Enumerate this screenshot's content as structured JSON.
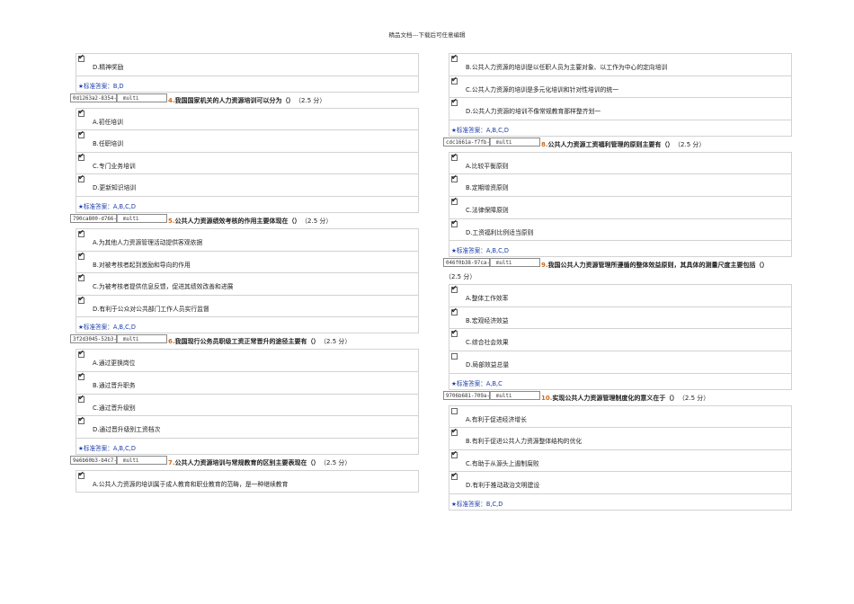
{
  "header": {
    "text": "精品文档---下载后可任意编辑"
  },
  "left": {
    "q3_tail": {
      "options": [
        {
          "label": "D.精神奖励",
          "checked": true
        }
      ],
      "answer_label": "★标准答案：",
      "answer": "B,D"
    },
    "questions": [
      {
        "id": "0d1263a2-8354-",
        "type": "multi",
        "number": "4.",
        "text": "我国国家机关的人力资源培训可以分为（）",
        "score": "（2.5 分）",
        "options": [
          {
            "label": "A.初任培训",
            "checked": true
          },
          {
            "label": "B.任职培训",
            "checked": true
          },
          {
            "label": "C.专门业务培训",
            "checked": true
          },
          {
            "label": "D.更新知识培训",
            "checked": true
          }
        ],
        "answer_label": "★标准答案：",
        "answer": "A,B,C,D"
      },
      {
        "id": "790ca800-d766-",
        "type": "multi",
        "number": "5.",
        "text": "公共人力资源绩效考核的作用主要体现在（）",
        "score": "（2.5 分）",
        "options": [
          {
            "label": "A.为其他人力资源管理活动提供客观依据",
            "checked": true
          },
          {
            "label": "B.对被考核者起到激励和导向的作用",
            "checked": true
          },
          {
            "label": "C.为被考核者提供信息反馈，促进其绩效改善和进展",
            "checked": true
          },
          {
            "label": "D.有利于公众对公共部门工作人员实行监督",
            "checked": true
          }
        ],
        "answer_label": "★标准答案：",
        "answer": "A,B,C,D"
      },
      {
        "id": "3f2d3045-52b3-",
        "type": "multi",
        "number": "6.",
        "text": "我国现行公务员职级工资正常晋升的途径主要有（）",
        "score": "（2.5 分）",
        "options": [
          {
            "label": "A.通过更换岗位",
            "checked": true
          },
          {
            "label": "B.通过晋升职务",
            "checked": true
          },
          {
            "label": "C.通过晋升级别",
            "checked": true
          },
          {
            "label": "D.通过晋升级别工资档次",
            "checked": true
          }
        ],
        "answer_label": "★标准答案：",
        "answer": "A,B,C,D"
      },
      {
        "id": "9e6b60b3-b4c7-",
        "type": "multi",
        "number": "7.",
        "text": "公共人力资源培训与常规教育的区别主要表现在（）",
        "score": "（2.5 分）",
        "options": [
          {
            "label": "A.公共人力资源的培训属于成人教育和职业教育的范畴，是一种继续教育",
            "checked": true
          }
        ],
        "answer_label": "",
        "answer": ""
      }
    ]
  },
  "right": {
    "q7_tail": {
      "options": [
        {
          "label": "B.公共人力资源的培训是以任职人员为主要对象、以工作为中心的定向培训",
          "checked": true
        },
        {
          "label": "C.公共人力资源的培训是多元化培训和针对性培训的统一",
          "checked": true
        },
        {
          "label": "D.公共人力资源的培训不像常规教育那样整齐划一",
          "checked": true
        }
      ],
      "answer_label": "★标准答案：",
      "answer": "A,B,C,D"
    },
    "questions": [
      {
        "id": "cdc1661a-f7fb-",
        "type": "multi",
        "number": "8.",
        "text": "公共人力资源工资福利管理的原则主要有（）",
        "score": "（2.5 分）",
        "options": [
          {
            "label": "A.比较平衡原则",
            "checked": true
          },
          {
            "label": "B.定期增资原则",
            "checked": true
          },
          {
            "label": "C.法律保障原则",
            "checked": true
          },
          {
            "label": "D.工资福利比例适当原则",
            "checked": true
          }
        ],
        "answer_label": "★标准答案：",
        "answer": "A,B,C,D"
      },
      {
        "id": "046f0b38-97ca-",
        "type": "multi",
        "number": "9.",
        "text": "我国公共人力资源管理所遵循的整体效益原则，其具体的测量尺度主要包括（）",
        "score": "",
        "continuation": "（2.5 分）",
        "options": [
          {
            "label": "A.整体工作效率",
            "checked": true
          },
          {
            "label": "B.宏观经济效益",
            "checked": true
          },
          {
            "label": "C.综合社会效果",
            "checked": true
          },
          {
            "label": "D.局部效益总量",
            "checked": false
          }
        ],
        "answer_label": "★标准答案：",
        "answer": "A,B,C"
      },
      {
        "id": "9706b681-709a-",
        "type": "multi",
        "number": "10.",
        "text": "实现公共人力资源管理制度化的意义在于（）",
        "score": "（2.5 分）",
        "options": [
          {
            "label": "A.有利于促进经济增长",
            "checked": false
          },
          {
            "label": "B.有利于促进公共人力资源整体结构的优化",
            "checked": true
          },
          {
            "label": "C.有助于从源头上遏制腐败",
            "checked": true
          },
          {
            "label": "D.有利于推动政治文明建设",
            "checked": true
          }
        ],
        "answer_label": "★标准答案：",
        "answer": "B,C,D"
      }
    ]
  }
}
